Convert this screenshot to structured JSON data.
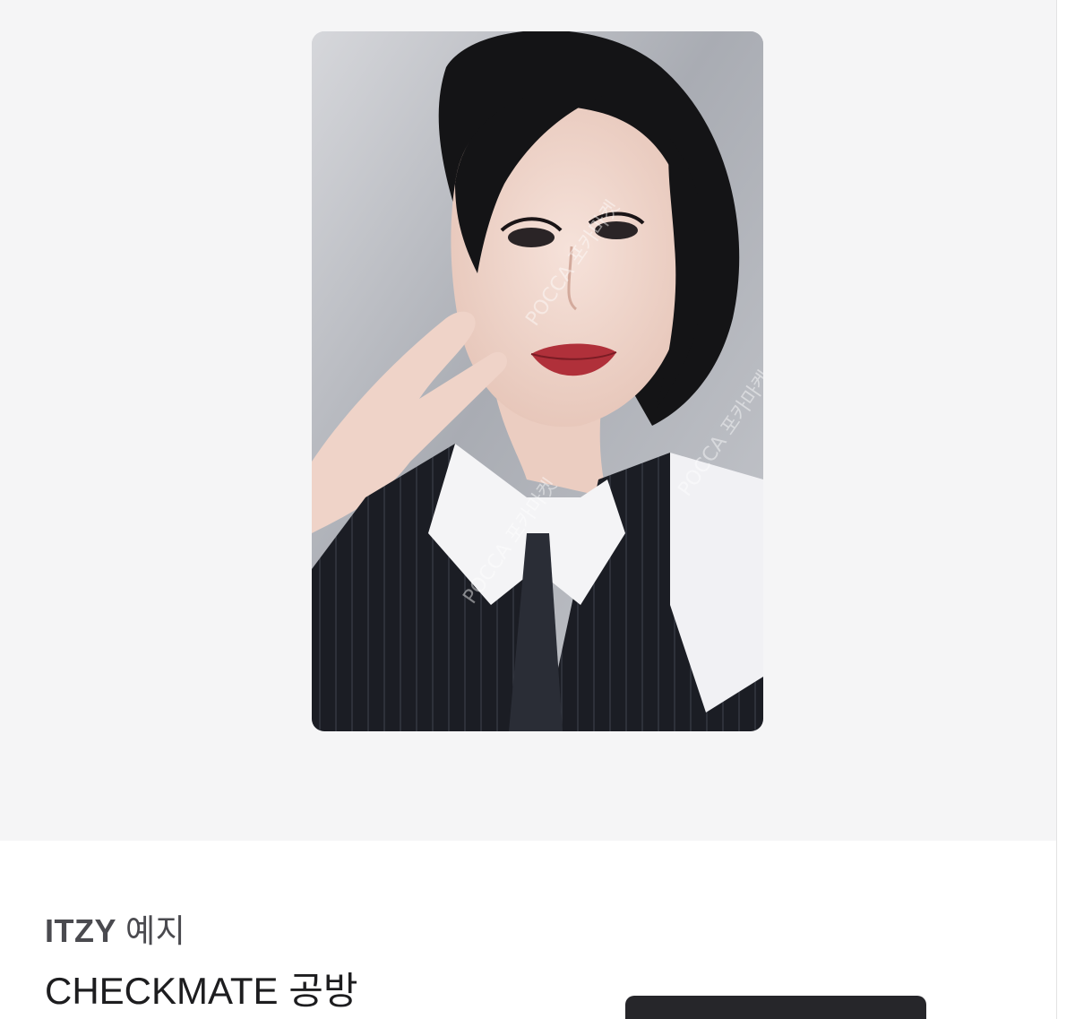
{
  "product": {
    "image": {
      "alt": "ITZY 예지 CHECKMATE 공방 photocard",
      "watermark_text": "POCCA 포카마켓",
      "colors": {
        "background": "#b9bbc1",
        "hair": "#141416",
        "skin": "#f0d9cf",
        "shirt": "#f4f4f6",
        "vest": "#1b1d24",
        "lips": "#b0303a"
      }
    },
    "artist_group": "ITZY",
    "artist_member": "예지",
    "album_title": "CHECKMATE 공방"
  },
  "colors": {
    "hero_background": "#f5f5f6",
    "title_text": "#1d1d1f",
    "artist_text": "#4a4a4f",
    "button_dark": "#26262a"
  }
}
